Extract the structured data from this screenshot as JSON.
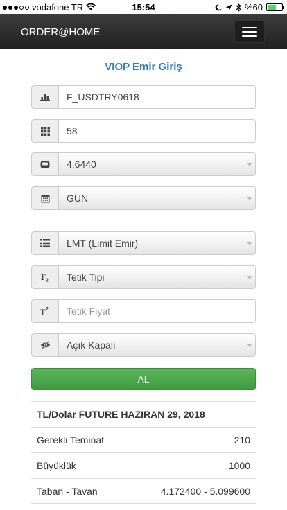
{
  "status_bar": {
    "carrier": "vodafone TR",
    "time": "15:54",
    "battery": "%60",
    "battery_level": 0.6
  },
  "navbar": {
    "brand": "ORDER@HOME"
  },
  "page_title": "VIOP Emir Giriş",
  "form": {
    "contract": {
      "value": "F_USDTRY0618",
      "icon": "bar-chart-icon"
    },
    "quantity": {
      "value": "58",
      "icon": "grid-icon"
    },
    "price": {
      "value": "4.6440",
      "icon": "price-tag-icon"
    },
    "validity": {
      "value": "GUN",
      "icon": "calendar-icon"
    },
    "order_type": {
      "value": "LMT (Limit Emir)",
      "icon": "list-icon"
    },
    "trigger_type": {
      "value": "Tetik Tipi",
      "icon": "subscript-icon"
    },
    "trigger_price": {
      "placeholder": "Tetik Fiyat",
      "icon": "superscript-icon"
    },
    "open_close": {
      "value": "Açık Kapalı",
      "icon": "eye-slash-icon"
    }
  },
  "submit_label": "AL",
  "submit_color": "#4cae4c",
  "info": {
    "title": "TL/Dolar FUTURE HAZIRAN 29, 2018",
    "rows": [
      {
        "label": "Gerekli Teminat",
        "value": "210"
      },
      {
        "label": "Büyüklük",
        "value": "1000"
      },
      {
        "label": "Taban - Tavan",
        "value": "4.172400 - 5.099600"
      }
    ]
  },
  "accent_color": "#2e7bbf"
}
